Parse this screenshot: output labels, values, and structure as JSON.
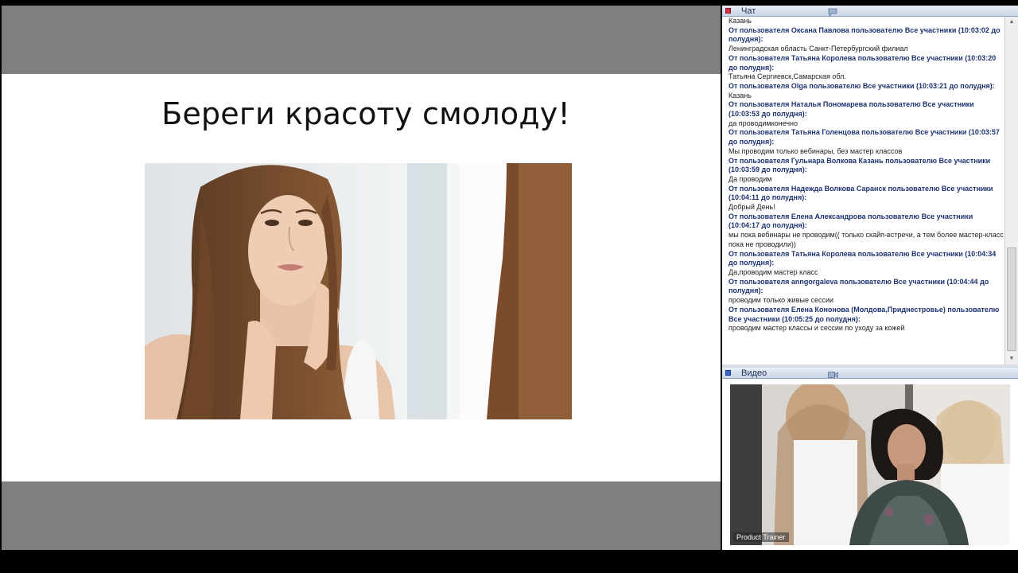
{
  "slide": {
    "title": "Береги красоту смолоду!"
  },
  "chat": {
    "title": "Чат",
    "messages": [
      {
        "header": "",
        "text": "Казань"
      },
      {
        "header": "От пользователя Оксана Павлова пользователю Все участники (10:03:02 до полудня):",
        "text": "Ленинградская область Санкт-Петербургский филиал"
      },
      {
        "header": "От пользователя Татьяна Королева пользователю Все участники (10:03:20 до полудня):",
        "text": "Татьяна Сергиевск,Самарская обл."
      },
      {
        "header": "От пользователя Olga пользователю Все участники (10:03:21 до полудня):",
        "text": "Казань"
      },
      {
        "header": "От пользователя Наталья Пономарева пользователю Все участники (10:03:53 до полудня):",
        "text": "да проводимконечно"
      },
      {
        "header": "От пользователя Татьяна Голенцова пользователю Все участники (10:03:57 до полудня):",
        "text": "Мы проводим только вебинары, без мастер классов"
      },
      {
        "header": "От пользователя Гульнара Волкова Казань пользователю Все участники (10:03:59 до полудня):",
        "text": "Да проводим"
      },
      {
        "header": "От пользователя Надежда Волкова Саранск пользователю Все участники (10:04:11 до полудня):",
        "text": "Добрый День!"
      },
      {
        "header": "От пользователя Елена Александрова пользователю Все участники (10:04:17 до полудня):",
        "text": "мы пока вебинары не проводим(( только скайп-встречи, а тем более мастер-класс пока не проводили))"
      },
      {
        "header": "От пользователя Татьяна Королева пользователю Все участники (10:04:34 до полудня):",
        "text": "Да,проводим мастер класс"
      },
      {
        "header": "От пользователя anngorgaleva пользователю Все участники (10:04:44 до полудня):",
        "text": "проводим только живые сессии"
      },
      {
        "header": "От пользователя Елена Кононова (Молдова,Приднестровье) пользователю Все участники (10:05:25 до полудня):",
        "text": "проводим мастер классы и сессии по уходу за кожей"
      }
    ]
  },
  "video": {
    "title": "Видео",
    "caption": "Product Trainer"
  },
  "colors": {
    "chat_header_text": "#1c3272",
    "panel_header_gradient_top": "#e8eef6",
    "panel_header_gradient_bottom": "#c9d5e6",
    "stage_gray": "#7f7f7f"
  },
  "icons": {
    "chat_pod_status": "red-square-icon",
    "chat_pod_menu": "speech-bubble-icon",
    "video_pod_status": "blue-square-icon",
    "video_pod_menu": "camera-icon"
  }
}
